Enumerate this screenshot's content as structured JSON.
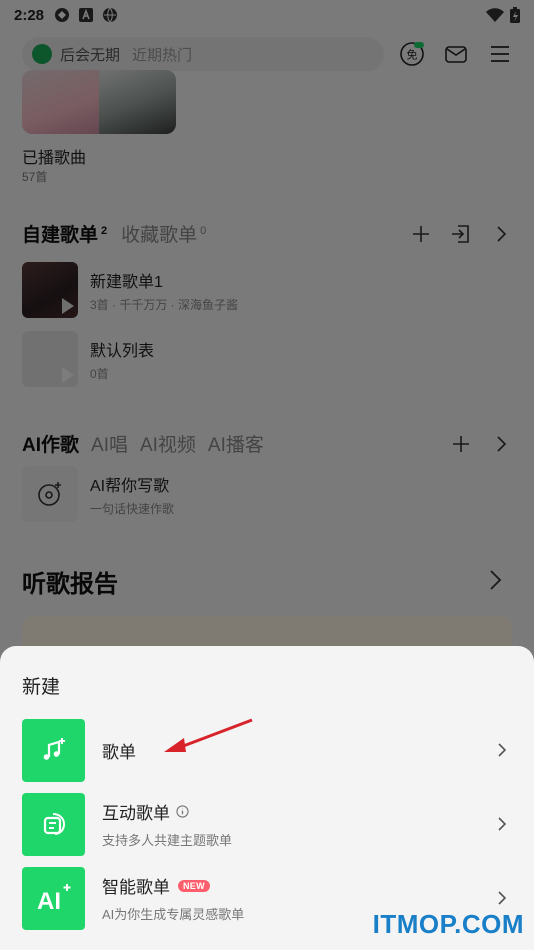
{
  "status_bar": {
    "time": "2:28"
  },
  "header": {
    "search_text": "后会无期",
    "search_suggestion": "近期热门",
    "vip_badge": "免"
  },
  "played": {
    "title": "已播歌曲",
    "count": "57首"
  },
  "playlists": {
    "tab_created": "自建歌单",
    "tab_created_count": "2",
    "tab_collected": "收藏歌单",
    "tab_collected_count": "0",
    "items": [
      {
        "title": "新建歌单1",
        "subtitle": "3首 · 千千万万 · 深海鱼子酱"
      },
      {
        "title": "默认列表",
        "subtitle": "0首"
      }
    ]
  },
  "ai_section": {
    "tabs": [
      "AI作歌",
      "AI唱",
      "AI视频",
      "AI播客"
    ],
    "item_title": "AI帮你写歌",
    "item_subtitle": "一句话快速作歌"
  },
  "report": {
    "title": "听歌报告"
  },
  "sheet": {
    "title": "新建",
    "options": [
      {
        "label": "歌单",
        "sub": ""
      },
      {
        "label": "互动歌单",
        "sub": "支持多人共建主题歌单"
      },
      {
        "label": "智能歌单",
        "sub": "AI为你生成专属灵感歌单",
        "badge": "NEW"
      }
    ],
    "ai_icon_text": "AI"
  },
  "watermark": "ITMOP.COM",
  "colors": {
    "accent": "#1fd66b",
    "badge": "#ff5f6d",
    "watermark": "#1a7fc9"
  }
}
